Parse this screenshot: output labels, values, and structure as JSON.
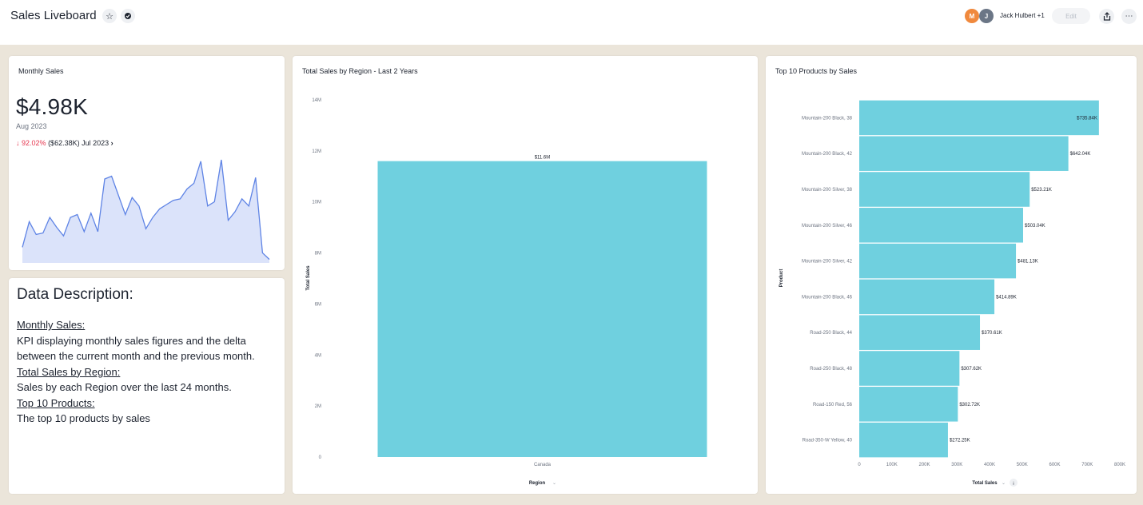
{
  "header": {
    "title": "Sales Liveboard",
    "star_icon": "star-icon",
    "verified_icon": "verified-icon",
    "avatars": [
      {
        "initial": "M",
        "color": "#f0893d"
      },
      {
        "initial": "J",
        "color": "#6b7686"
      }
    ],
    "editors_label": "Jack Hulbert +1",
    "edit_label": "Edit",
    "share_icon": "share-icon",
    "more_icon": "more-icon"
  },
  "kpi": {
    "title": "Monthly Sales",
    "value": "$4.98K",
    "date": "Aug 2023",
    "delta_arrow": "↓",
    "delta_percent": "92.02%",
    "delta_detail": "($62.38K) Jul 2023",
    "chevron": "›",
    "sparkline_color": "#5f84e5",
    "sparkline_fill": "#dbe3fa"
  },
  "description": {
    "heading": "Data Description:",
    "monthly_heading": "Monthly Sales:",
    "monthly_text": "KPI displaying monthly sales figures and the delta between the current month and the previous month.",
    "region_heading": "Total Sales by Region:",
    "region_text": "Sales by each Region over the last 24 months.",
    "top10_heading": "Top 10 Products:",
    "top10_text": "The top 10 products by sales"
  },
  "chart_data": [
    {
      "type": "line",
      "title": "Monthly Sales",
      "values": [
        22,
        58,
        40,
        42,
        64,
        50,
        38,
        64,
        68,
        44,
        70,
        44,
        118,
        122,
        95,
        68,
        92,
        80,
        48,
        64,
        76,
        82,
        88,
        90,
        104,
        112,
        143,
        80,
        86,
        145,
        60,
        72,
        90,
        80,
        120,
        14,
        5
      ],
      "ylim": [
        0,
        145
      ]
    },
    {
      "type": "bar",
      "title": "Total Sales by Region - Last 2 Years",
      "categories": [
        "Canada"
      ],
      "values": [
        11.6
      ],
      "data_labels": [
        "$11.6M"
      ],
      "xlabel": "Region",
      "ylabel": "Total Sales",
      "ylim": [
        0,
        14
      ],
      "y_ticks": [
        "0",
        "2M",
        "4M",
        "6M",
        "8M",
        "10M",
        "12M",
        "14M"
      ],
      "color": "#6fd0df"
    },
    {
      "type": "bar",
      "orientation": "horizontal",
      "title": "Top 10 Products by Sales",
      "categories": [
        "Mountain-200 Black, 38",
        "Mountain-200 Black, 42",
        "Mountain-200 Silver, 38",
        "Mountain-200 Silver, 46",
        "Mountain-200 Silver, 42",
        "Mountain-200 Black, 46",
        "Road-250 Black, 44",
        "Road-250 Black, 48",
        "Road-150 Red, 56",
        "Road-350-W Yellow, 40"
      ],
      "values": [
        735.84,
        642.04,
        523.21,
        503.04,
        481.13,
        414.89,
        370.61,
        307.62,
        302.72,
        272.25
      ],
      "data_labels": [
        "$735.84K",
        "$642.04K",
        "$523.21K",
        "$503.04K",
        "$481.13K",
        "$414.89K",
        "$370.61K",
        "$307.62K",
        "$302.72K",
        "$272.25K"
      ],
      "xlabel": "Total Sales",
      "ylabel": "Product",
      "xlim": [
        0,
        800
      ],
      "x_ticks": [
        "0",
        "100K",
        "200K",
        "300K",
        "400K",
        "500K",
        "600K",
        "700K",
        "800K"
      ],
      "color": "#6fd0df"
    }
  ]
}
